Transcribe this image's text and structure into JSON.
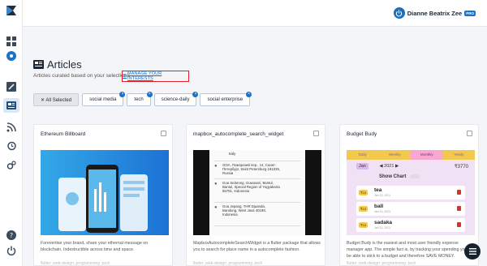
{
  "user": {
    "name": "Dianne Beatrix Zee",
    "badge": "PRO"
  },
  "page": {
    "title": "Articles",
    "subtitle": "Articles curated based on your selections",
    "manage_link": "MANAGE YOUR INTERESTS"
  },
  "chips": [
    {
      "label": "✕ All Selected"
    },
    {
      "label": "social media"
    },
    {
      "label": "tech"
    },
    {
      "label": "science-daily"
    },
    {
      "label": "social enterprise"
    }
  ],
  "cards": [
    {
      "title": "Ethereum Billboard",
      "desc": "Forevertise your brand, share your ethernal message on blockchain. Indestructible across time and space.",
      "tags": "flutter ,web-design ,programming ,tech"
    },
    {
      "title": "mapbox_autocomplete_search_widget",
      "desc": "MapboxAutocompleteSearchWidget is a flutter package that allows you to search for place name in a autocomplete fashion.",
      "tags": "flutter ,web-design ,programming ,tech",
      "places": [
        "Italy",
        "GOA, Пожарский пер., 14, Санкт-Петербург, Saint Petersburg 191025, Russia",
        "Goa Selarong, Guwosari, Bantul, Bantul, Special Region of Yogyakarta 55751, Indonesia",
        "Goa Jepang, THR Djuanda, Bandung, West Java 40198, Indonesia"
      ]
    },
    {
      "title": "Budget Budy",
      "desc": "Budget Budy is the easiest and most user friendly expense manager app. The simple fact is, by tracking your spending you will be able to stick to a budget and therefore SAVE MONEY.",
      "tags": "flutter ,web-design ,programming ,tech",
      "app": {
        "tabs": [
          "Daily",
          "Weekly",
          "Monthly",
          "Yearly"
        ],
        "month": "Jan",
        "year": "2021",
        "amount": "₹3770",
        "show_chart": "Show Chart",
        "items": [
          {
            "amount": "₹10",
            "name": "tea",
            "date": "Jan 13, 2021"
          },
          {
            "amount": "₹10",
            "name": "ball",
            "date": "Jan 13, 2021"
          },
          {
            "amount": "₹10",
            "name": "sadaka",
            "date": "Jan 13, 2021"
          }
        ]
      }
    }
  ],
  "colors": {
    "accent": "#1a73c9",
    "highlight": "#e41e26",
    "dark": "#16232f"
  }
}
